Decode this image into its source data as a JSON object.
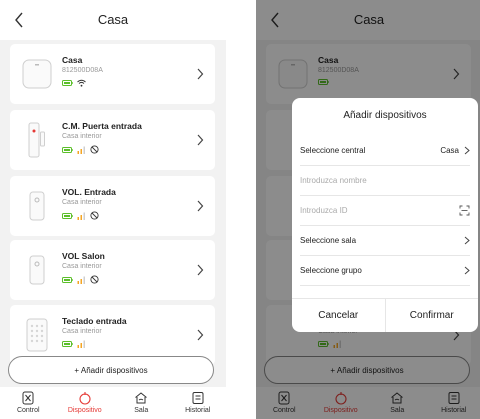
{
  "header": {
    "title": "Casa",
    "back_icon": "chevron-left-icon"
  },
  "devices": [
    {
      "name": "Casa",
      "subtitle": "812500D08A",
      "icon": "hub-icon",
      "status": [
        "battery-icon",
        "wifi-icon"
      ]
    },
    {
      "name": "C.M. Puerta entrada",
      "subtitle": "Casa interior",
      "icon": "door-sensor-icon",
      "status": [
        "battery-icon",
        "signal-icon",
        "bypass-icon"
      ]
    },
    {
      "name": "VOL. Entrada",
      "subtitle": "Casa interior",
      "icon": "pir-sensor-icon",
      "status": [
        "battery-icon",
        "signal-icon",
        "bypass-icon"
      ]
    },
    {
      "name": "VOL Salon",
      "subtitle": "Casa interior",
      "icon": "pir-sensor-icon",
      "status": [
        "battery-icon",
        "signal-icon",
        "bypass-icon"
      ]
    },
    {
      "name": "Teclado entrada",
      "subtitle": "Casa interior",
      "icon": "keypad-icon",
      "status": [
        "battery-icon",
        "signal-icon"
      ]
    }
  ],
  "add_button": "+ Añadir dispositivos",
  "tabs": [
    {
      "label": "Control",
      "icon": "control-icon",
      "active": false
    },
    {
      "label": "Dispositivo",
      "icon": "device-icon",
      "active": true
    },
    {
      "label": "Sala",
      "icon": "home-icon",
      "active": false
    },
    {
      "label": "Historial",
      "icon": "history-icon",
      "active": false
    }
  ],
  "modal": {
    "title": "Añadir dispositivos",
    "central_label": "Seleccione central",
    "central_value": "Casa",
    "name_placeholder": "Introduzca nombre",
    "id_placeholder": "Introduzca ID",
    "room_label": "Seleccione sala",
    "group_label": "Seleccione grupo",
    "cancel": "Cancelar",
    "confirm": "Confirmar"
  },
  "colors": {
    "accent": "#e53935",
    "battery": "#5cbf2a",
    "signal": "#f5a623",
    "background": "#f2f2f2"
  }
}
